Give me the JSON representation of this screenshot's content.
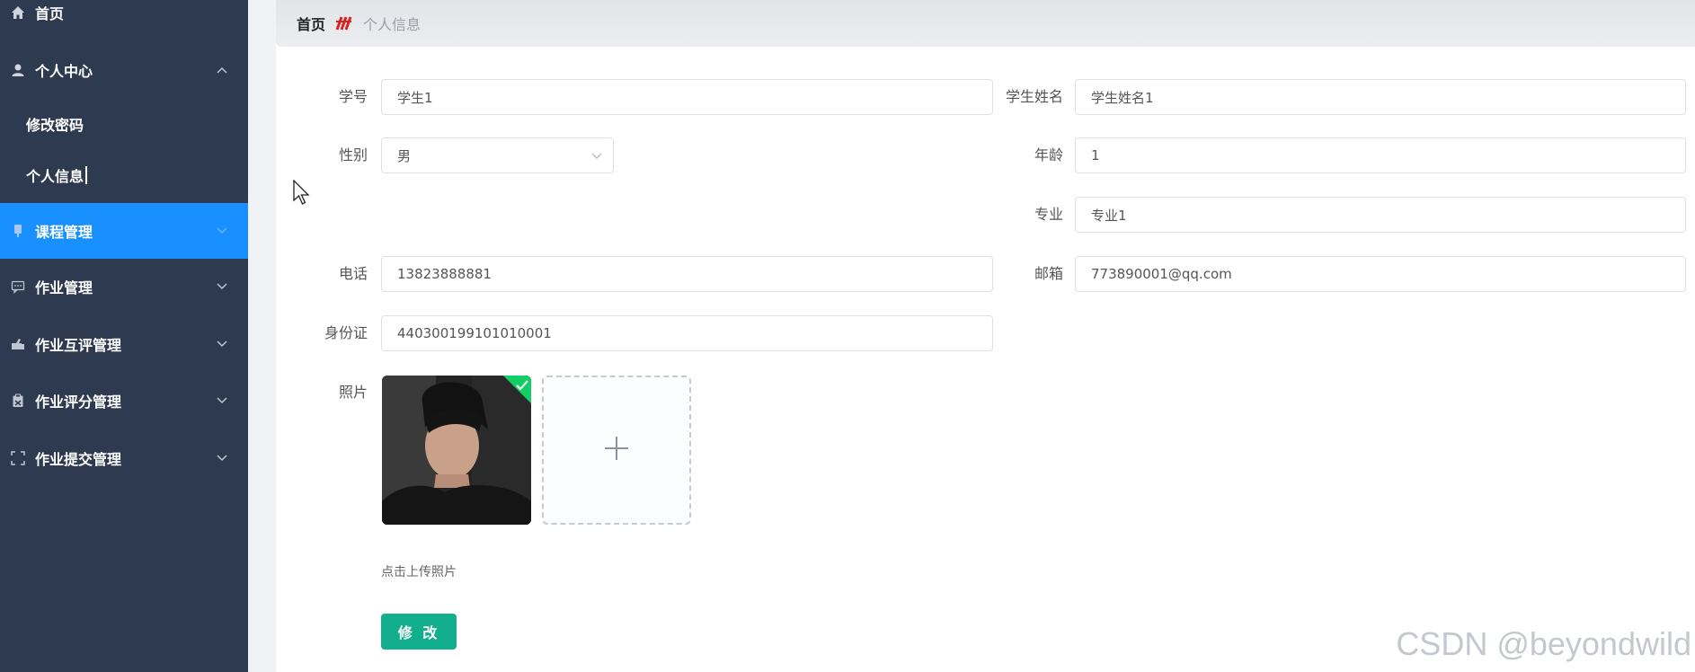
{
  "sidebar": {
    "menu": [
      {
        "label": "首页",
        "icon": "home-icon",
        "has_arrow": false
      },
      {
        "label": "个人中心",
        "icon": "user-icon",
        "has_arrow": true,
        "expanded": true
      },
      {
        "label": "课程管理",
        "icon": "course-icon",
        "has_arrow": true,
        "active": true
      },
      {
        "label": "作业管理",
        "icon": "message-icon",
        "has_arrow": true
      },
      {
        "label": "作业互评管理",
        "icon": "peer-review-icon",
        "has_arrow": true
      },
      {
        "label": "作业评分管理",
        "icon": "clipboard-icon",
        "has_arrow": true
      },
      {
        "label": "作业提交管理",
        "icon": "frame-icon",
        "has_arrow": true
      }
    ],
    "submenu": [
      {
        "label": "修改密码"
      },
      {
        "label": "个人信息"
      }
    ],
    "colors": {
      "background": "#2e3a4f",
      "active": "#1890ff"
    }
  },
  "breadcrumb": {
    "home": "首页",
    "current": "个人信息"
  },
  "form": {
    "student_no": {
      "label": "学号",
      "value": "学生1"
    },
    "student_name": {
      "label": "学生姓名",
      "value": "学生姓名1"
    },
    "gender": {
      "label": "性别",
      "value": "男"
    },
    "age": {
      "label": "年龄",
      "value": "1"
    },
    "major": {
      "label": "专业",
      "value": "专业1"
    },
    "phone": {
      "label": "电话",
      "value": "13823888881"
    },
    "email": {
      "label": "邮箱",
      "value": "773890001@qq.com"
    },
    "id_card": {
      "label": "身份证",
      "value": "440300199101010001"
    },
    "photo": {
      "label": "照片",
      "upload_tip": "点击上传照片"
    },
    "submit_label": "修 改"
  },
  "watermark": "CSDN @beyondwild",
  "colors": {
    "primary_button": "#13ae8d",
    "success_check": "#13ce66"
  }
}
